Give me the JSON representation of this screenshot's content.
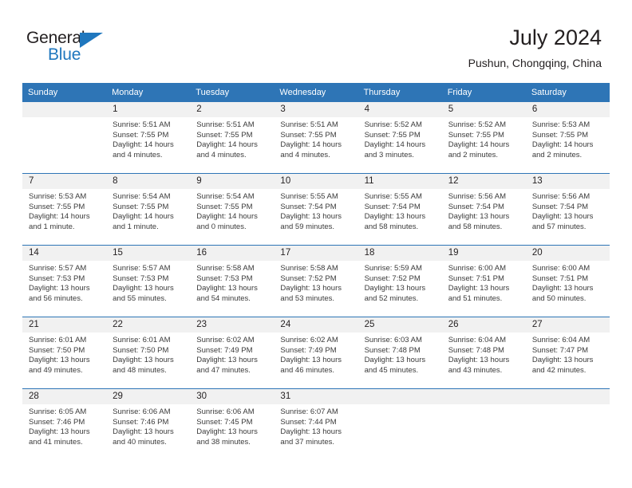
{
  "brand": {
    "name_part1": "General",
    "name_part2": "Blue",
    "color_primary": "#1f77be",
    "color_text": "#231f20"
  },
  "header": {
    "title": "July 2024",
    "subtitle": "Pushun, Chongqing, China"
  },
  "theme": {
    "header_bg": "#2e75b6",
    "daynum_bg": "#f1f1f1",
    "text": "#231f20"
  },
  "weekdays": [
    "Sunday",
    "Monday",
    "Tuesday",
    "Wednesday",
    "Thursday",
    "Friday",
    "Saturday"
  ],
  "weeks": [
    [
      {
        "day": "",
        "lines": []
      },
      {
        "day": "1",
        "lines": [
          "Sunrise: 5:51 AM",
          "Sunset: 7:55 PM",
          "Daylight: 14 hours",
          "and 4 minutes."
        ]
      },
      {
        "day": "2",
        "lines": [
          "Sunrise: 5:51 AM",
          "Sunset: 7:55 PM",
          "Daylight: 14 hours",
          "and 4 minutes."
        ]
      },
      {
        "day": "3",
        "lines": [
          "Sunrise: 5:51 AM",
          "Sunset: 7:55 PM",
          "Daylight: 14 hours",
          "and 4 minutes."
        ]
      },
      {
        "day": "4",
        "lines": [
          "Sunrise: 5:52 AM",
          "Sunset: 7:55 PM",
          "Daylight: 14 hours",
          "and 3 minutes."
        ]
      },
      {
        "day": "5",
        "lines": [
          "Sunrise: 5:52 AM",
          "Sunset: 7:55 PM",
          "Daylight: 14 hours",
          "and 2 minutes."
        ]
      },
      {
        "day": "6",
        "lines": [
          "Sunrise: 5:53 AM",
          "Sunset: 7:55 PM",
          "Daylight: 14 hours",
          "and 2 minutes."
        ]
      }
    ],
    [
      {
        "day": "7",
        "lines": [
          "Sunrise: 5:53 AM",
          "Sunset: 7:55 PM",
          "Daylight: 14 hours",
          "and 1 minute."
        ]
      },
      {
        "day": "8",
        "lines": [
          "Sunrise: 5:54 AM",
          "Sunset: 7:55 PM",
          "Daylight: 14 hours",
          "and 1 minute."
        ]
      },
      {
        "day": "9",
        "lines": [
          "Sunrise: 5:54 AM",
          "Sunset: 7:55 PM",
          "Daylight: 14 hours",
          "and 0 minutes."
        ]
      },
      {
        "day": "10",
        "lines": [
          "Sunrise: 5:55 AM",
          "Sunset: 7:54 PM",
          "Daylight: 13 hours",
          "and 59 minutes."
        ]
      },
      {
        "day": "11",
        "lines": [
          "Sunrise: 5:55 AM",
          "Sunset: 7:54 PM",
          "Daylight: 13 hours",
          "and 58 minutes."
        ]
      },
      {
        "day": "12",
        "lines": [
          "Sunrise: 5:56 AM",
          "Sunset: 7:54 PM",
          "Daylight: 13 hours",
          "and 58 minutes."
        ]
      },
      {
        "day": "13",
        "lines": [
          "Sunrise: 5:56 AM",
          "Sunset: 7:54 PM",
          "Daylight: 13 hours",
          "and 57 minutes."
        ]
      }
    ],
    [
      {
        "day": "14",
        "lines": [
          "Sunrise: 5:57 AM",
          "Sunset: 7:53 PM",
          "Daylight: 13 hours",
          "and 56 minutes."
        ]
      },
      {
        "day": "15",
        "lines": [
          "Sunrise: 5:57 AM",
          "Sunset: 7:53 PM",
          "Daylight: 13 hours",
          "and 55 minutes."
        ]
      },
      {
        "day": "16",
        "lines": [
          "Sunrise: 5:58 AM",
          "Sunset: 7:53 PM",
          "Daylight: 13 hours",
          "and 54 minutes."
        ]
      },
      {
        "day": "17",
        "lines": [
          "Sunrise: 5:58 AM",
          "Sunset: 7:52 PM",
          "Daylight: 13 hours",
          "and 53 minutes."
        ]
      },
      {
        "day": "18",
        "lines": [
          "Sunrise: 5:59 AM",
          "Sunset: 7:52 PM",
          "Daylight: 13 hours",
          "and 52 minutes."
        ]
      },
      {
        "day": "19",
        "lines": [
          "Sunrise: 6:00 AM",
          "Sunset: 7:51 PM",
          "Daylight: 13 hours",
          "and 51 minutes."
        ]
      },
      {
        "day": "20",
        "lines": [
          "Sunrise: 6:00 AM",
          "Sunset: 7:51 PM",
          "Daylight: 13 hours",
          "and 50 minutes."
        ]
      }
    ],
    [
      {
        "day": "21",
        "lines": [
          "Sunrise: 6:01 AM",
          "Sunset: 7:50 PM",
          "Daylight: 13 hours",
          "and 49 minutes."
        ]
      },
      {
        "day": "22",
        "lines": [
          "Sunrise: 6:01 AM",
          "Sunset: 7:50 PM",
          "Daylight: 13 hours",
          "and 48 minutes."
        ]
      },
      {
        "day": "23",
        "lines": [
          "Sunrise: 6:02 AM",
          "Sunset: 7:49 PM",
          "Daylight: 13 hours",
          "and 47 minutes."
        ]
      },
      {
        "day": "24",
        "lines": [
          "Sunrise: 6:02 AM",
          "Sunset: 7:49 PM",
          "Daylight: 13 hours",
          "and 46 minutes."
        ]
      },
      {
        "day": "25",
        "lines": [
          "Sunrise: 6:03 AM",
          "Sunset: 7:48 PM",
          "Daylight: 13 hours",
          "and 45 minutes."
        ]
      },
      {
        "day": "26",
        "lines": [
          "Sunrise: 6:04 AM",
          "Sunset: 7:48 PM",
          "Daylight: 13 hours",
          "and 43 minutes."
        ]
      },
      {
        "day": "27",
        "lines": [
          "Sunrise: 6:04 AM",
          "Sunset: 7:47 PM",
          "Daylight: 13 hours",
          "and 42 minutes."
        ]
      }
    ],
    [
      {
        "day": "28",
        "lines": [
          "Sunrise: 6:05 AM",
          "Sunset: 7:46 PM",
          "Daylight: 13 hours",
          "and 41 minutes."
        ]
      },
      {
        "day": "29",
        "lines": [
          "Sunrise: 6:06 AM",
          "Sunset: 7:46 PM",
          "Daylight: 13 hours",
          "and 40 minutes."
        ]
      },
      {
        "day": "30",
        "lines": [
          "Sunrise: 6:06 AM",
          "Sunset: 7:45 PM",
          "Daylight: 13 hours",
          "and 38 minutes."
        ]
      },
      {
        "day": "31",
        "lines": [
          "Sunrise: 6:07 AM",
          "Sunset: 7:44 PM",
          "Daylight: 13 hours",
          "and 37 minutes."
        ]
      },
      {
        "day": "",
        "lines": []
      },
      {
        "day": "",
        "lines": []
      },
      {
        "day": "",
        "lines": []
      }
    ]
  ]
}
